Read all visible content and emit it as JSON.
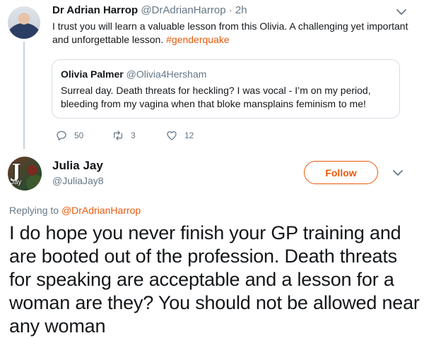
{
  "parent_tweet": {
    "name": "Dr Adrian Harrop",
    "handle": "@DrAdrianHarrop",
    "separator": " · ",
    "time": "2h",
    "text_before_hashtag": "I trust you will learn a valuable lesson from this Olivia. A challenging yet important and unforgettable lesson. ",
    "hashtag": "#genderquake",
    "quoted": {
      "name": "Olivia Palmer",
      "handle": "@Olivia4Hersham",
      "text": "Surreal day. Death threats for heckling? I was vocal - I’m on my period, bleeding from my vagina when that bloke mansplains feminism to me!"
    },
    "actions": {
      "replies": "50",
      "retweets": "3",
      "likes": "12"
    }
  },
  "main_tweet": {
    "name": "Julia Jay",
    "handle": "@JuliaJay8",
    "avatar_letter": "J",
    "avatar_text": "Jay",
    "follow_label": "Follow",
    "replying_prefix": "Replying to ",
    "replying_handle": "@DrAdrianHarrop",
    "text": "I do hope you never finish your GP training and are booted out of the profession. Death threats for speaking are acceptable and a lesson for a woman are they? You should not be allowed near any woman"
  },
  "colors": {
    "accent": "#e8590c",
    "secondary_text": "#657786",
    "primary_text": "#14171a",
    "border": "#d8dee4"
  }
}
